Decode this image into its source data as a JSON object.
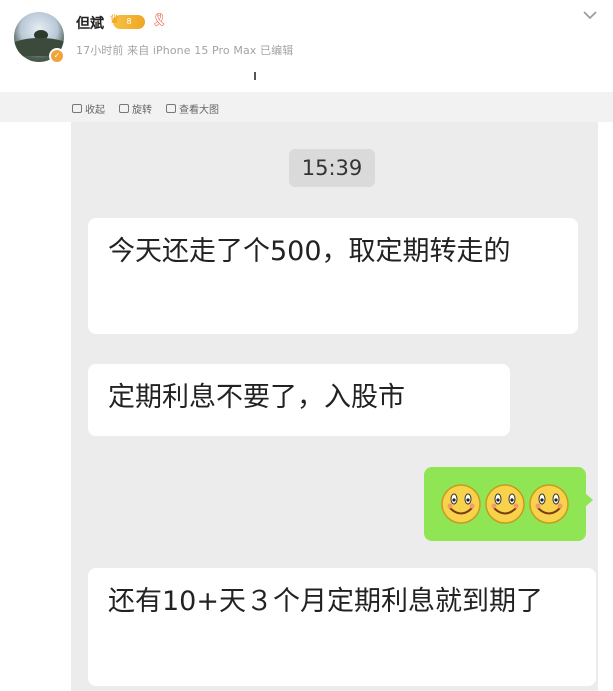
{
  "post": {
    "username": "但斌",
    "vip_label": "8",
    "meta_text": "17小时前 来自 iPhone 15 Pro Max 已编辑"
  },
  "actions": [
    {
      "label": "收起",
      "icon": "collapse-icon"
    },
    {
      "label": "旋转",
      "icon": "rotate-icon"
    },
    {
      "label": "查看大图",
      "icon": "view-large-image-icon"
    }
  ],
  "chat": {
    "time": "15:39",
    "messages": [
      {
        "side": "left",
        "text": "今天还走了个500，取定期转走的"
      },
      {
        "side": "left",
        "text": "定期利息不要了，入股市"
      },
      {
        "side": "right",
        "type": "emoji",
        "emojis": [
          "smile-emoji",
          "smile-emoji",
          "smile-emoji"
        ]
      },
      {
        "side": "left",
        "text": "还有10+天３个月定期利息就到期了"
      }
    ]
  },
  "colors": {
    "chat_background": "#ececec",
    "self_bubble": "#8fe553",
    "other_bubble": "#ffffff",
    "vip_gold": "#f0a524"
  }
}
